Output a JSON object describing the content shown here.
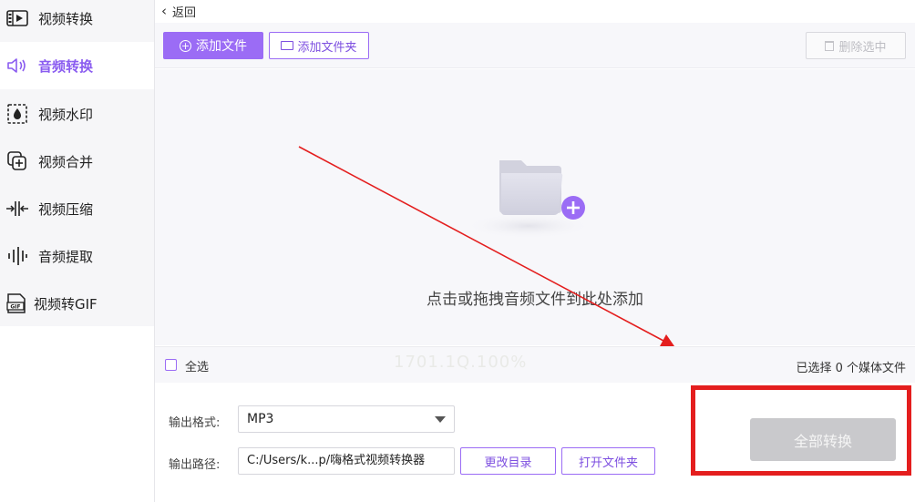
{
  "sidebar": {
    "items": [
      {
        "label": "视频转换",
        "icon": "film-convert-icon",
        "active": false
      },
      {
        "label": "音频转换",
        "icon": "speaker-icon",
        "active": true
      },
      {
        "label": "视频水印",
        "icon": "watermark-drop-icon",
        "active": false
      },
      {
        "label": "视频合并",
        "icon": "merge-plus-icon",
        "active": false
      },
      {
        "label": "视频压缩",
        "icon": "compress-icon",
        "active": false
      },
      {
        "label": "音频提取",
        "icon": "audio-wave-icon",
        "active": false
      },
      {
        "label": "视频转GIF",
        "icon": "gif-icon",
        "active": false
      }
    ]
  },
  "header": {
    "back_label": "返回"
  },
  "toolbar": {
    "add_file_label": "添加文件",
    "add_folder_label": "添加文件夹",
    "delete_selected_label": "删除选中"
  },
  "dropzone": {
    "hint": "点击或拖拽音频文件到此处添加"
  },
  "selection": {
    "select_all_label": "全选",
    "watermark_text": "1701.1Q.100%",
    "count_text": "已选择 0 个媒体文件"
  },
  "output": {
    "format_label": "输出格式:",
    "format_value": "MP3",
    "path_label": "输出路径:",
    "path_value": "C:/Users/k...p/嗨格式视频转换器",
    "change_dir_label": "更改目录",
    "open_folder_label": "打开文件夹"
  },
  "convert": {
    "label": "全部转换"
  },
  "colors": {
    "accent": "#9b6cf5",
    "annotation_red": "#e41e1e",
    "disabled_button": "#c9c9cc"
  }
}
